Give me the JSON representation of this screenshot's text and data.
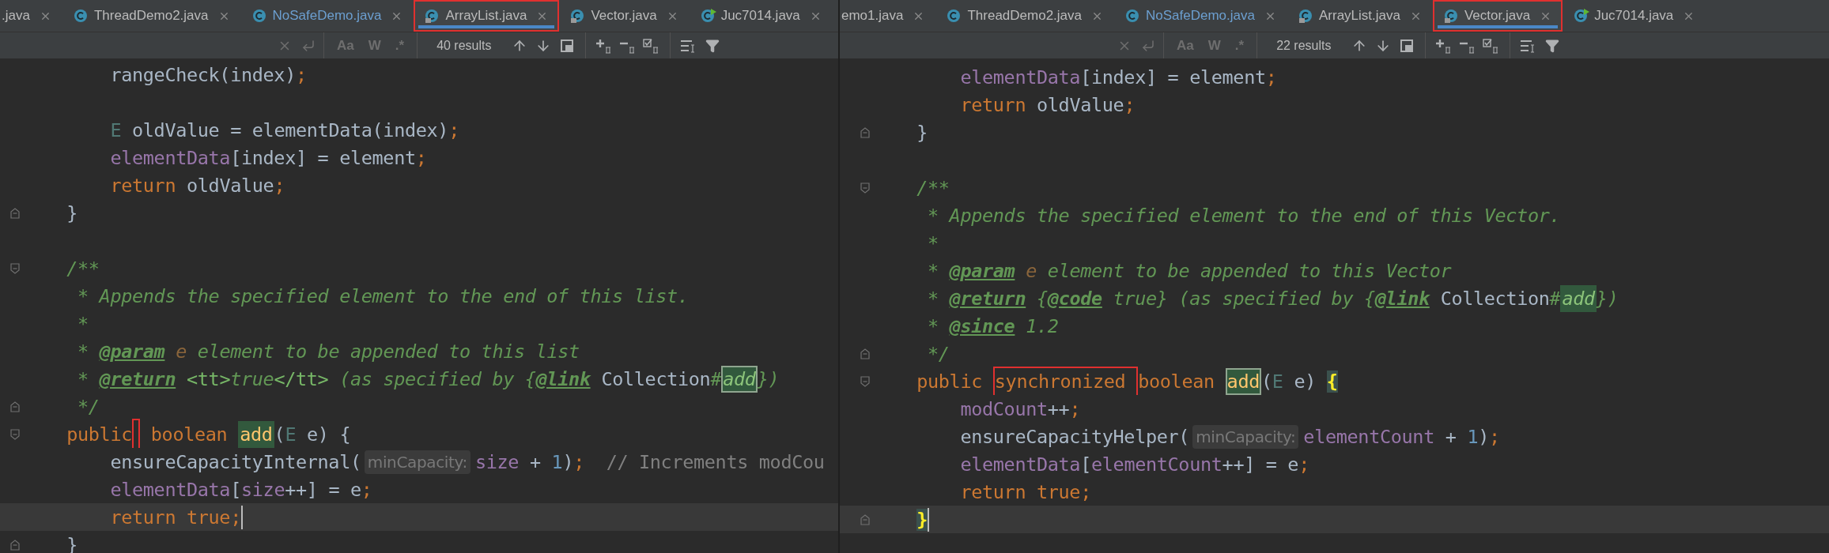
{
  "panes": [
    {
      "tabs": [
        {
          "label": ".java",
          "kind": "plain",
          "selected": false,
          "modified": false,
          "outlined": false
        },
        {
          "label": "ThreadDemo2.java",
          "kind": "class",
          "selected": false,
          "modified": false,
          "outlined": false
        },
        {
          "label": "NoSafeDemo.java",
          "kind": "class",
          "selected": false,
          "modified": true,
          "outlined": false
        },
        {
          "label": "ArrayList.java",
          "kind": "locked-class",
          "selected": true,
          "modified": false,
          "outlined": true
        },
        {
          "label": "Vector.java",
          "kind": "locked-class",
          "selected": false,
          "modified": false,
          "outlined": false
        },
        {
          "label": "Juc7014.java",
          "kind": "run-class",
          "selected": false,
          "modified": false,
          "outlined": false
        }
      ],
      "find_bar": {
        "toggles": [
          "Aa",
          "W",
          ".*"
        ],
        "results": "40 results"
      },
      "lines": [
        {
          "kind": "plain",
          "current": false,
          "tokens": [
            {
              "kind": "plain",
              "text": "        rangeCheck(index)"
            },
            {
              "kind": "punct",
              "text": ";"
            }
          ]
        },
        {
          "kind": "plain",
          "current": false
        },
        {
          "kind": "plain",
          "current": false,
          "tokens": [
            {
              "kind": "type-param",
              "text": "        E"
            },
            {
              "kind": "plain",
              "text": " oldValue = elementData(index)"
            },
            {
              "kind": "punct",
              "text": ";"
            }
          ]
        },
        {
          "kind": "plain",
          "current": false,
          "tokens": [
            {
              "kind": "field",
              "text": "        elementData"
            },
            {
              "kind": "plain",
              "text": "[index] = element"
            },
            {
              "kind": "punct",
              "text": ";"
            }
          ]
        },
        {
          "kind": "plain",
          "current": false,
          "tokens": [
            {
              "kind": "keyword",
              "text": "        return"
            },
            {
              "kind": "plain",
              "text": " oldValue"
            },
            {
              "kind": "punct",
              "text": ";"
            }
          ]
        },
        {
          "kind": "fold-end",
          "current": false,
          "tokens": [
            {
              "kind": "plain",
              "text": "    }"
            }
          ]
        },
        {
          "kind": "plain",
          "current": false
        },
        {
          "kind": "fold-start",
          "current": false,
          "tokens": [
            {
              "kind": "doc",
              "text": "    /**"
            }
          ]
        },
        {
          "kind": "plain",
          "current": false,
          "tokens": [
            {
              "kind": "doc",
              "text": "     * Appends the specified element to the end of this list."
            }
          ]
        },
        {
          "kind": "plain",
          "current": false,
          "tokens": [
            {
              "kind": "doc",
              "text": "     *"
            }
          ]
        },
        {
          "kind": "plain",
          "current": false,
          "tokens": [
            {
              "kind": "doc",
              "text": "     * "
            },
            {
              "kind": "doc-tag",
              "text": "@param"
            },
            {
              "kind": "param-ref",
              "text": " e"
            },
            {
              "kind": "doc",
              "text": " element to be appended to this list"
            }
          ]
        },
        {
          "kind": "plain",
          "current": false,
          "tokens": [
            {
              "kind": "doc",
              "text": "     * "
            },
            {
              "kind": "doc-tag",
              "text": "@return"
            },
            {
              "kind": "doc-markup",
              "text": " <tt>"
            },
            {
              "kind": "doc",
              "text": "true"
            },
            {
              "kind": "doc-markup",
              "text": "</tt>"
            },
            {
              "kind": "doc",
              "text": " (as specified by {"
            },
            {
              "kind": "doc-tag",
              "text": "@link"
            },
            {
              "kind": "doc-ref",
              "text": " Collection"
            },
            {
              "kind": "doc",
              "text": "#"
            },
            {
              "kind": "doc-match",
              "text": "add",
              "current": true
            },
            {
              "kind": "doc",
              "text": "})"
            }
          ]
        },
        {
          "kind": "fold-end",
          "current": false,
          "tokens": [
            {
              "kind": "doc",
              "text": "     */"
            }
          ]
        },
        {
          "kind": "fold-start",
          "current": false,
          "tokens": [
            {
              "kind": "keyword",
              "text": "    public"
            },
            {
              "kind": "marker"
            },
            {
              "kind": "keyword",
              "text": " boolean "
            },
            {
              "kind": "method-match",
              "text": "add",
              "current": false
            },
            {
              "kind": "plain",
              "text": "("
            },
            {
              "kind": "type-param",
              "text": "E"
            },
            {
              "kind": "plain",
              "text": " e) {"
            }
          ]
        },
        {
          "kind": "plain",
          "current": false,
          "tokens": [
            {
              "kind": "plain",
              "text": "        ensureCapacityInternal("
            },
            {
              "kind": "hint",
              "text": "minCapacity:"
            },
            {
              "kind": "field",
              "text": "size"
            },
            {
              "kind": "plain",
              "text": " + "
            },
            {
              "kind": "number",
              "text": "1"
            },
            {
              "kind": "plain",
              "text": ")"
            },
            {
              "kind": "punct",
              "text": ";"
            },
            {
              "kind": "comment",
              "text": "  // Increments modCou"
            }
          ]
        },
        {
          "kind": "plain",
          "current": false,
          "tokens": [
            {
              "kind": "field",
              "text": "        elementData"
            },
            {
              "kind": "plain",
              "text": "["
            },
            {
              "kind": "field",
              "text": "size"
            },
            {
              "kind": "plain",
              "text": "++] = e"
            },
            {
              "kind": "punct",
              "text": ";"
            }
          ]
        },
        {
          "kind": "plain",
          "current": true,
          "tokens": [
            {
              "kind": "keyword",
              "text": "        return true"
            },
            {
              "kind": "punct",
              "text": ";"
            },
            {
              "kind": "caret"
            }
          ]
        },
        {
          "kind": "fold-end",
          "current": false,
          "tokens": [
            {
              "kind": "plain",
              "text": "    }"
            }
          ]
        }
      ]
    },
    {
      "tabs": [
        {
          "label": "emo1.java",
          "kind": "plain",
          "selected": false,
          "modified": false,
          "outlined": false
        },
        {
          "label": "ThreadDemo2.java",
          "kind": "class",
          "selected": false,
          "modified": false,
          "outlined": false
        },
        {
          "label": "NoSafeDemo.java",
          "kind": "class",
          "selected": false,
          "modified": true,
          "outlined": false
        },
        {
          "label": "ArrayList.java",
          "kind": "locked-class",
          "selected": false,
          "modified": false,
          "outlined": false
        },
        {
          "label": "Vector.java",
          "kind": "locked-class",
          "selected": true,
          "modified": false,
          "outlined": true
        },
        {
          "label": "Juc7014.java",
          "kind": "run-class",
          "selected": false,
          "modified": false,
          "outlined": false
        }
      ],
      "find_bar": {
        "toggles": [
          "Aa",
          "W",
          ".*"
        ],
        "results": "22 results"
      },
      "lines": [
        {
          "kind": "plain",
          "current": false,
          "tokens": [
            {
              "kind": "field",
              "text": "        elementData"
            },
            {
              "kind": "plain",
              "text": "[index] = element"
            },
            {
              "kind": "punct",
              "text": ";"
            }
          ]
        },
        {
          "kind": "plain",
          "current": false,
          "tokens": [
            {
              "kind": "keyword",
              "text": "        return"
            },
            {
              "kind": "plain",
              "text": " oldValue"
            },
            {
              "kind": "punct",
              "text": ";"
            }
          ]
        },
        {
          "kind": "fold-end",
          "current": false,
          "tokens": [
            {
              "kind": "plain",
              "text": "    }"
            }
          ]
        },
        {
          "kind": "plain",
          "current": false
        },
        {
          "kind": "fold-start",
          "current": false,
          "tokens": [
            {
              "kind": "doc",
              "text": "    /**"
            }
          ]
        },
        {
          "kind": "plain",
          "current": false,
          "tokens": [
            {
              "kind": "doc",
              "text": "     * Appends the specified element to the end of this Vector."
            }
          ]
        },
        {
          "kind": "plain",
          "current": false,
          "tokens": [
            {
              "kind": "doc",
              "text": "     *"
            }
          ]
        },
        {
          "kind": "plain",
          "current": false,
          "tokens": [
            {
              "kind": "doc",
              "text": "     * "
            },
            {
              "kind": "doc-tag",
              "text": "@param"
            },
            {
              "kind": "param-ref",
              "text": " e"
            },
            {
              "kind": "doc",
              "text": " element to be appended to this Vector"
            }
          ]
        },
        {
          "kind": "plain",
          "current": false,
          "tokens": [
            {
              "kind": "doc",
              "text": "     * "
            },
            {
              "kind": "doc-tag",
              "text": "@return"
            },
            {
              "kind": "doc",
              "text": " {"
            },
            {
              "kind": "doc-tag",
              "text": "@code"
            },
            {
              "kind": "doc",
              "text": " true} (as specified by {"
            },
            {
              "kind": "doc-tag",
              "text": "@link"
            },
            {
              "kind": "doc-ref",
              "text": " Collection"
            },
            {
              "kind": "doc",
              "text": "#"
            },
            {
              "kind": "doc-match",
              "text": "add",
              "current": false
            },
            {
              "kind": "doc",
              "text": "})"
            }
          ]
        },
        {
          "kind": "plain",
          "current": false,
          "tokens": [
            {
              "kind": "doc",
              "text": "     * "
            },
            {
              "kind": "doc-tag",
              "text": "@since"
            },
            {
              "kind": "doc",
              "text": " 1.2"
            }
          ]
        },
        {
          "kind": "fold-end",
          "current": false,
          "tokens": [
            {
              "kind": "doc",
              "text": "     */"
            }
          ]
        },
        {
          "kind": "fold-start",
          "current": false,
          "tokens": [
            {
              "kind": "keyword",
              "text": "    public "
            },
            {
              "kind": "outlined",
              "text": "synchronized "
            },
            {
              "kind": "keyword",
              "text": "boolean "
            },
            {
              "kind": "method-match",
              "text": "add",
              "current": true
            },
            {
              "kind": "plain",
              "text": "("
            },
            {
              "kind": "type-param",
              "text": "E"
            },
            {
              "kind": "plain",
              "text": " e) "
            },
            {
              "kind": "brace",
              "text": "{"
            }
          ]
        },
        {
          "kind": "plain",
          "current": false,
          "tokens": [
            {
              "kind": "field",
              "text": "        modCount"
            },
            {
              "kind": "plain",
              "text": "++"
            },
            {
              "kind": "punct",
              "text": ";"
            }
          ]
        },
        {
          "kind": "plain",
          "current": false,
          "tokens": [
            {
              "kind": "plain",
              "text": "        ensureCapacityHelper("
            },
            {
              "kind": "hint",
              "text": "minCapacity:"
            },
            {
              "kind": "field",
              "text": "elementCount"
            },
            {
              "kind": "plain",
              "text": " + "
            },
            {
              "kind": "number",
              "text": "1"
            },
            {
              "kind": "plain",
              "text": ")"
            },
            {
              "kind": "punct",
              "text": ";"
            }
          ]
        },
        {
          "kind": "plain",
          "current": false,
          "tokens": [
            {
              "kind": "field",
              "text": "        elementData"
            },
            {
              "kind": "plain",
              "text": "["
            },
            {
              "kind": "field",
              "text": "elementCount"
            },
            {
              "kind": "plain",
              "text": "++] = e"
            },
            {
              "kind": "punct",
              "text": ";"
            }
          ]
        },
        {
          "kind": "plain",
          "current": false,
          "tokens": [
            {
              "kind": "keyword",
              "text": "        return true"
            },
            {
              "kind": "punct",
              "text": ";"
            }
          ]
        },
        {
          "kind": "fold-end",
          "current": true,
          "tokens": [
            {
              "kind": "brace",
              "text": "    }"
            },
            {
              "kind": "caret"
            }
          ]
        }
      ]
    }
  ]
}
